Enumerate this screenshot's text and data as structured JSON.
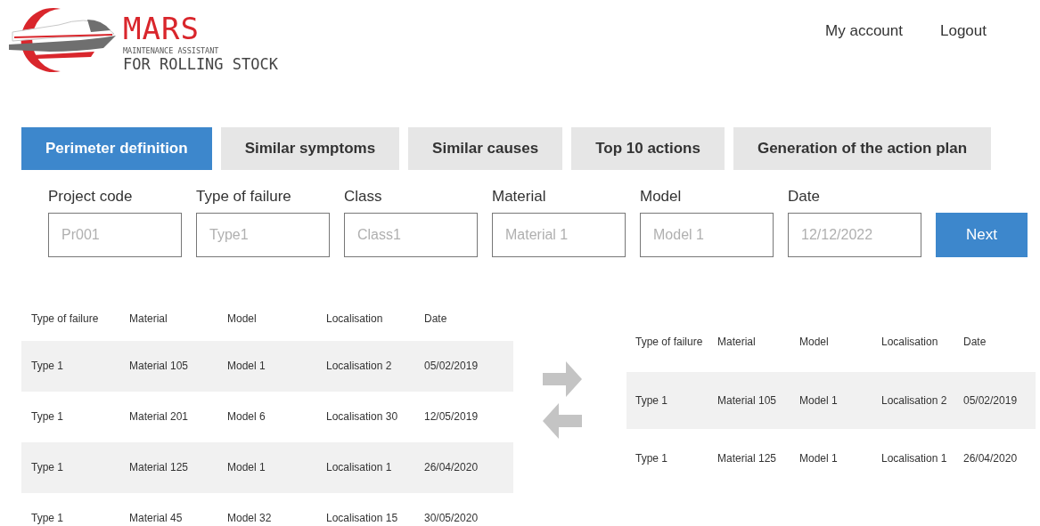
{
  "logo": {
    "name": "MARS",
    "subtitle": "MAINTENANCE ASSISTANT",
    "tagline": "FOR ROLLING STOCK"
  },
  "nav": [
    "My account",
    "Logout"
  ],
  "tabs": [
    {
      "label": "Perimeter definition",
      "selected": true
    },
    {
      "label": "Similar symptoms",
      "selected": false
    },
    {
      "label": "Similar causes",
      "selected": false
    },
    {
      "label": "Top 10 actions",
      "selected": false
    },
    {
      "label": "Generation of the action plan",
      "selected": false
    }
  ],
  "fields": [
    {
      "label": "Project code",
      "placeholder": "Pr001"
    },
    {
      "label": "Type of failure",
      "placeholder": "Type1"
    },
    {
      "label": "Class",
      "placeholder": "Class1"
    },
    {
      "label": "Material",
      "placeholder": "Material 1"
    },
    {
      "label": "Model",
      "placeholder": "Model 1"
    },
    {
      "label": "Date",
      "placeholder": "12/12/2022"
    }
  ],
  "next_button": "Next",
  "source_table": {
    "columns": [
      "Type of failure",
      "Material",
      "Model",
      "Localisation",
      "Date"
    ],
    "rows": [
      [
        "Type 1",
        "Material 105",
        "Model 1",
        "Localisation 2",
        "05/02/2019"
      ],
      [
        "Type 1",
        "Material 201",
        "Model 6",
        "Localisation 30",
        "12/05/2019"
      ],
      [
        "Type 1",
        "Material 125",
        "Model 1",
        "Localisation 1",
        "26/04/2020"
      ],
      [
        "Type 1",
        "Material 45",
        "Model 32",
        "Localisation 15",
        "30/05/2020"
      ]
    ]
  },
  "selected_table": {
    "columns": [
      "Type of failure",
      "Material",
      "Model",
      "Localisation",
      "Date"
    ],
    "rows": [
      [
        "Type 1",
        "Material 105",
        "Model 1",
        "Localisation 2",
        "05/02/2019"
      ],
      [
        "Type 1",
        "Material 125",
        "Model 1",
        "Localisation 1",
        "26/04/2020"
      ]
    ]
  }
}
